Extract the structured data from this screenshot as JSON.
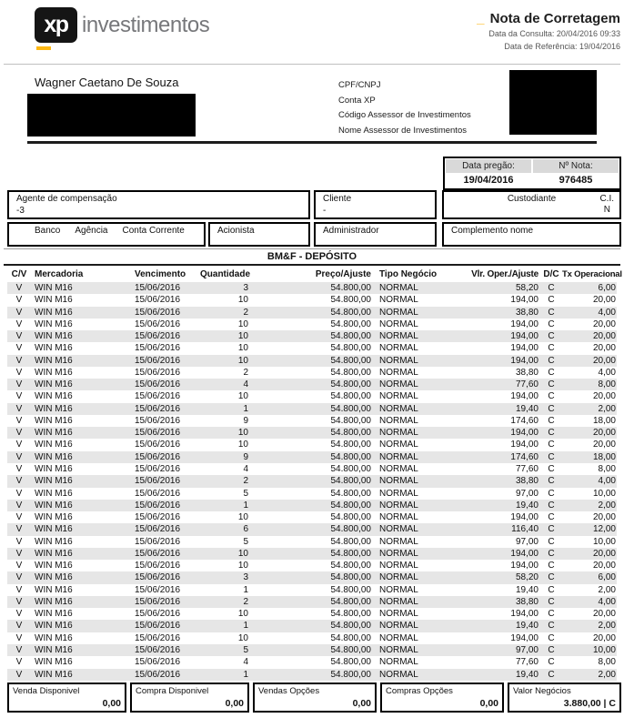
{
  "brand": {
    "logo_square": "xp",
    "logo_text": "investimentos",
    "accent_color": "#FDB813"
  },
  "header": {
    "title_prefix": "_",
    "title": "Nota de Corretagem",
    "consulta": "Data da Consulta: 20/04/2016 09:33",
    "referencia": "Data de Referência: 19/04/2016"
  },
  "client": {
    "name": "Wagner Caetano De Souza",
    "labels": [
      "CPF/CNPJ",
      "Conta XP",
      "Código Assessor de Investimentos",
      "Nome Assessor de Investimentos"
    ]
  },
  "note_info": {
    "data_pregao_label": "Data pregão:",
    "data_pregao": "19/04/2016",
    "numero_nota_label": "Nº Nota:",
    "numero_nota": "976485"
  },
  "boxes": {
    "agente_label": "Agente de compensação",
    "agente_value": "-3",
    "cliente_label": "Cliente",
    "cliente_value": "-",
    "custodiante_label": "Custodiante",
    "ci_label": "C.I.",
    "ci_value": "N",
    "banco_label": "Banco",
    "agencia_label": "Agência",
    "conta_corrente_label": "Conta Corrente",
    "acionista_label": "Acionista",
    "administrador_label": "Administrador",
    "complemento_label": "Complemento nome"
  },
  "section_title": "BM&F - DEPÓSITO",
  "table": {
    "headers": [
      "C/V",
      "Mercadoria",
      "Vencimento",
      "Quantidade",
      "Preço/Ajuste",
      "Tipo Negócio",
      "Vlr. Oper./Ajuste",
      "D/C",
      "Tx Operacional"
    ],
    "rows": [
      [
        "V",
        "WIN M16",
        "15/06/2016",
        "3",
        "54.800,00",
        "NORMAL",
        "58,20",
        "C",
        "6,00"
      ],
      [
        "V",
        "WIN M16",
        "15/06/2016",
        "10",
        "54.800,00",
        "NORMAL",
        "194,00",
        "C",
        "20,00"
      ],
      [
        "V",
        "WIN M16",
        "15/06/2016",
        "2",
        "54.800,00",
        "NORMAL",
        "38,80",
        "C",
        "4,00"
      ],
      [
        "V",
        "WIN M16",
        "15/06/2016",
        "10",
        "54.800,00",
        "NORMAL",
        "194,00",
        "C",
        "20,00"
      ],
      [
        "V",
        "WIN M16",
        "15/06/2016",
        "10",
        "54.800,00",
        "NORMAL",
        "194,00",
        "C",
        "20,00"
      ],
      [
        "V",
        "WIN M16",
        "15/06/2016",
        "10",
        "54.800,00",
        "NORMAL",
        "194,00",
        "C",
        "20,00"
      ],
      [
        "V",
        "WIN M16",
        "15/06/2016",
        "10",
        "54.800,00",
        "NORMAL",
        "194,00",
        "C",
        "20,00"
      ],
      [
        "V",
        "WIN M16",
        "15/06/2016",
        "2",
        "54.800,00",
        "NORMAL",
        "38,80",
        "C",
        "4,00"
      ],
      [
        "V",
        "WIN M16",
        "15/06/2016",
        "4",
        "54.800,00",
        "NORMAL",
        "77,60",
        "C",
        "8,00"
      ],
      [
        "V",
        "WIN M16",
        "15/06/2016",
        "10",
        "54.800,00",
        "NORMAL",
        "194,00",
        "C",
        "20,00"
      ],
      [
        "V",
        "WIN M16",
        "15/06/2016",
        "1",
        "54.800,00",
        "NORMAL",
        "19,40",
        "C",
        "2,00"
      ],
      [
        "V",
        "WIN M16",
        "15/06/2016",
        "9",
        "54.800,00",
        "NORMAL",
        "174,60",
        "C",
        "18,00"
      ],
      [
        "V",
        "WIN M16",
        "15/06/2016",
        "10",
        "54.800,00",
        "NORMAL",
        "194,00",
        "C",
        "20,00"
      ],
      [
        "V",
        "WIN M16",
        "15/06/2016",
        "10",
        "54.800,00",
        "NORMAL",
        "194,00",
        "C",
        "20,00"
      ],
      [
        "V",
        "WIN M16",
        "15/06/2016",
        "9",
        "54.800,00",
        "NORMAL",
        "174,60",
        "C",
        "18,00"
      ],
      [
        "V",
        "WIN M16",
        "15/06/2016",
        "4",
        "54.800,00",
        "NORMAL",
        "77,60",
        "C",
        "8,00"
      ],
      [
        "V",
        "WIN M16",
        "15/06/2016",
        "2",
        "54.800,00",
        "NORMAL",
        "38,80",
        "C",
        "4,00"
      ],
      [
        "V",
        "WIN M16",
        "15/06/2016",
        "5",
        "54.800,00",
        "NORMAL",
        "97,00",
        "C",
        "10,00"
      ],
      [
        "V",
        "WIN M16",
        "15/06/2016",
        "1",
        "54.800,00",
        "NORMAL",
        "19,40",
        "C",
        "2,00"
      ],
      [
        "V",
        "WIN M16",
        "15/06/2016",
        "10",
        "54.800,00",
        "NORMAL",
        "194,00",
        "C",
        "20,00"
      ],
      [
        "V",
        "WIN M16",
        "15/06/2016",
        "6",
        "54.800,00",
        "NORMAL",
        "116,40",
        "C",
        "12,00"
      ],
      [
        "V",
        "WIN M16",
        "15/06/2016",
        "5",
        "54.800,00",
        "NORMAL",
        "97,00",
        "C",
        "10,00"
      ],
      [
        "V",
        "WIN M16",
        "15/06/2016",
        "10",
        "54.800,00",
        "NORMAL",
        "194,00",
        "C",
        "20,00"
      ],
      [
        "V",
        "WIN M16",
        "15/06/2016",
        "10",
        "54.800,00",
        "NORMAL",
        "194,00",
        "C",
        "20,00"
      ],
      [
        "V",
        "WIN M16",
        "15/06/2016",
        "3",
        "54.800,00",
        "NORMAL",
        "58,20",
        "C",
        "6,00"
      ],
      [
        "V",
        "WIN M16",
        "15/06/2016",
        "1",
        "54.800,00",
        "NORMAL",
        "19,40",
        "C",
        "2,00"
      ],
      [
        "V",
        "WIN M16",
        "15/06/2016",
        "2",
        "54.800,00",
        "NORMAL",
        "38,80",
        "C",
        "4,00"
      ],
      [
        "V",
        "WIN M16",
        "15/06/2016",
        "10",
        "54.800,00",
        "NORMAL",
        "194,00",
        "C",
        "20,00"
      ],
      [
        "V",
        "WIN M16",
        "15/06/2016",
        "1",
        "54.800,00",
        "NORMAL",
        "19,40",
        "C",
        "2,00"
      ],
      [
        "V",
        "WIN M16",
        "15/06/2016",
        "10",
        "54.800,00",
        "NORMAL",
        "194,00",
        "C",
        "20,00"
      ],
      [
        "V",
        "WIN M16",
        "15/06/2016",
        "5",
        "54.800,00",
        "NORMAL",
        "97,00",
        "C",
        "10,00"
      ],
      [
        "V",
        "WIN M16",
        "15/06/2016",
        "4",
        "54.800,00",
        "NORMAL",
        "77,60",
        "C",
        "8,00"
      ],
      [
        "V",
        "WIN M16",
        "15/06/2016",
        "1",
        "54.800,00",
        "NORMAL",
        "19,40",
        "C",
        "2,00"
      ]
    ]
  },
  "footer": {
    "boxes": [
      {
        "label": "Venda Disponivel",
        "value": "0,00"
      },
      {
        "label": "Compra Disponivel",
        "value": "0,00"
      },
      {
        "label": "Vendas Opções",
        "value": "0,00"
      },
      {
        "label": "Compras Opções",
        "value": "0,00"
      },
      {
        "label": "Valor Negócios",
        "value": "3.880,00 | C"
      }
    ]
  },
  "colors": {
    "accent": "#FDB813",
    "row_alt": "#E6E6E6",
    "note_info_header_bg": "#D9D9D9"
  }
}
